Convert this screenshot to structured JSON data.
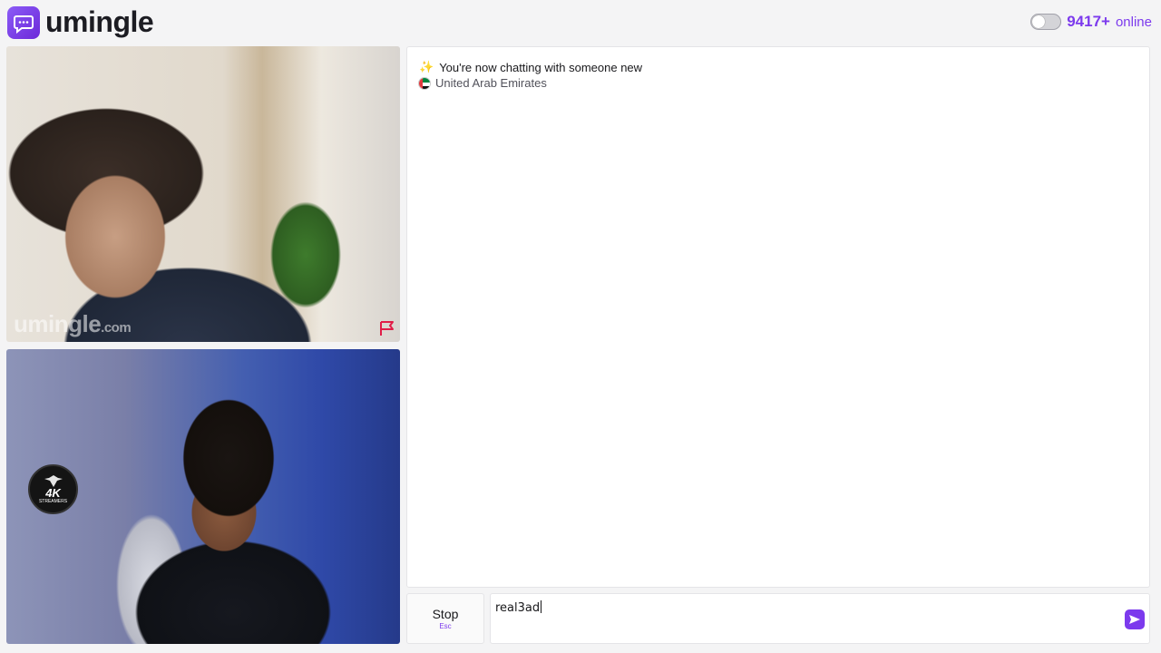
{
  "header": {
    "logo_text": "umingle",
    "online_count": "9417+",
    "online_label": "online"
  },
  "videos": {
    "watermark_main": "umingle",
    "watermark_suffix": ".com",
    "channel_badge_main": "4K",
    "channel_badge_sub": "STREAMERS"
  },
  "chat": {
    "system_message": "You're now chatting with someone new",
    "country": "United Arab Emirates"
  },
  "controls": {
    "stop_label": "Stop",
    "stop_shortcut": "Esc",
    "message_value": "real3ad"
  },
  "icons": {
    "logo": "chat-bubble-icon",
    "toggle": "toggle-switch-icon",
    "report": "flag-report-icon",
    "sparkle": "sparkle-icon",
    "country_flag": "uae-flag-icon",
    "send": "send-arrow-icon"
  },
  "colors": {
    "accent": "#7c3aed",
    "report": "#e11d48"
  }
}
